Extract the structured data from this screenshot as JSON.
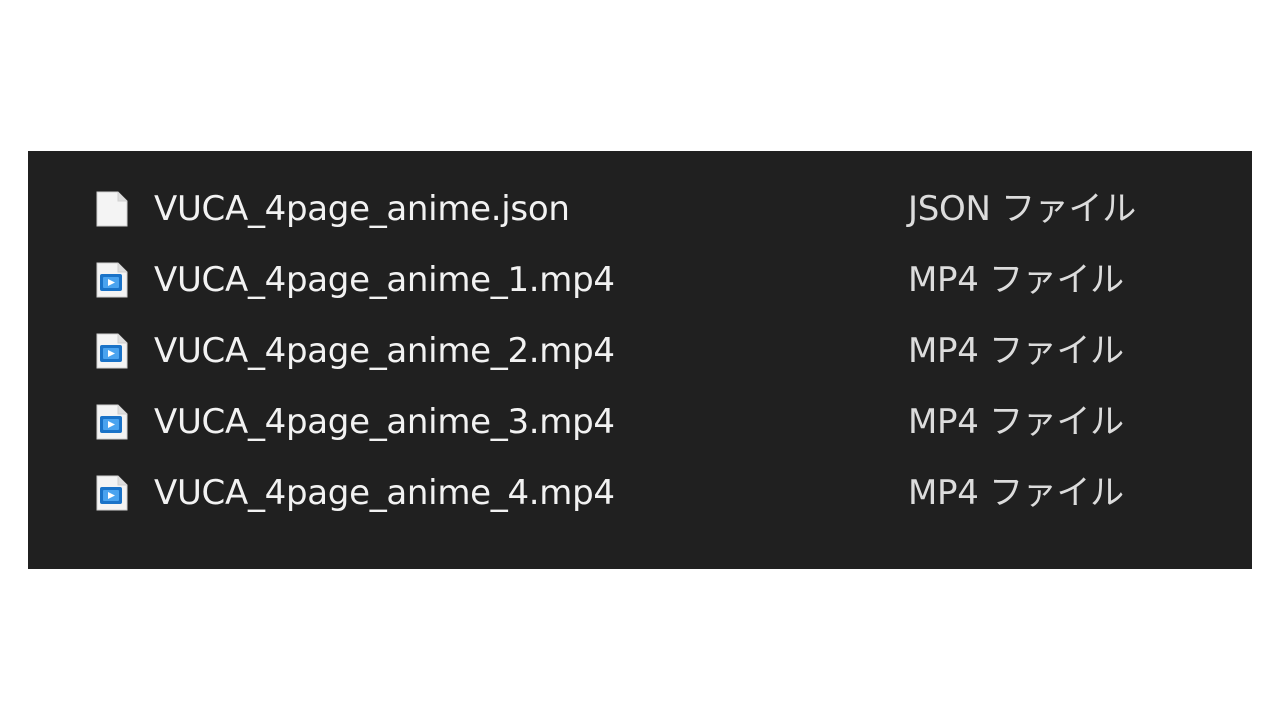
{
  "files": [
    {
      "name": "VUCA_4page_anime.json",
      "type": "JSON ファイル",
      "icon": "json-file-icon"
    },
    {
      "name": "VUCA_4page_anime_1.mp4",
      "type": "MP4 ファイル",
      "icon": "mp4-video-file-icon"
    },
    {
      "name": "VUCA_4page_anime_2.mp4",
      "type": "MP4 ファイル",
      "icon": "mp4-video-file-icon"
    },
    {
      "name": "VUCA_4page_anime_3.mp4",
      "type": "MP4 ファイル",
      "icon": "mp4-video-file-icon"
    },
    {
      "name": "VUCA_4page_anime_4.mp4",
      "type": "MP4 ファイル",
      "icon": "mp4-video-file-icon"
    }
  ],
  "colors": {
    "panel_background": "#202020",
    "page_background": "#ffffff",
    "text_primary": "#f2f2f2",
    "video_icon_accent": "#1a73c8"
  }
}
